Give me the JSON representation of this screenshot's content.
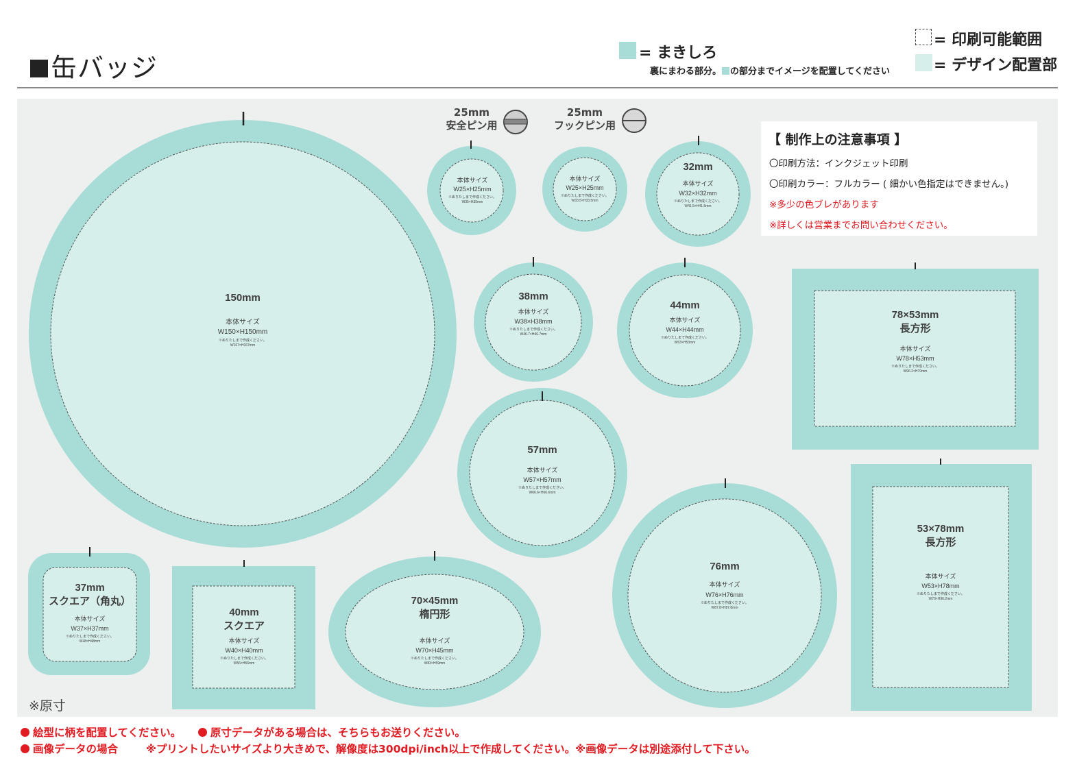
{
  "title": "缶バッジ",
  "legend": {
    "makishiro_label": "= まきしろ",
    "makishiro_note_a": "裏にまわる部分。",
    "makishiro_note_b": "の部分までイメージを配置してください",
    "print_area_label": "= 印刷可能範囲",
    "design_area_label": "= デザイン配置部"
  },
  "pins": {
    "safety_size": "25mm",
    "safety_label": "安全ピン用",
    "hook_size": "25mm",
    "hook_label": "フックピン用"
  },
  "notes": {
    "heading": "【 制作上の注意事項 】",
    "method": "〇印刷方法：インクジェット印刷",
    "color": "〇印刷カラー：フルカラー ( 細かい色指定はできません。)",
    "warn1": "※多少の色ブレがあります",
    "warn2": "※詳しくは営業までお問い合わせください。"
  },
  "colors": {
    "makishiro": "#a8dcd6",
    "design": "#d7efeb",
    "panel": "#eef0ef",
    "warning": "#e01b22"
  },
  "common": {
    "body_label": "本体サイズ",
    "bleed_note": "※ぬりたしまで作成ください。"
  },
  "badges": {
    "b150": {
      "size": "150mm",
      "body": "W150×H150mm",
      "full": "W167×H167mm"
    },
    "b25s": {
      "body": "W25×H25mm",
      "full": "W35×H35mm"
    },
    "b25h": {
      "body": "W25×H25mm",
      "full": "W33.5×H33.5mm"
    },
    "b32": {
      "size": "32mm",
      "body": "W32×H32mm",
      "full": "W41.5×H41.5mm"
    },
    "b38": {
      "size": "38mm",
      "body": "W38×H38mm",
      "full": "W46.7×H46.7mm"
    },
    "b44": {
      "size": "44mm",
      "body": "W44×H44mm",
      "full": "W53×H53mm"
    },
    "b57": {
      "size": "57mm",
      "body": "W57×H57mm",
      "full": "W66.6×H66.6mm"
    },
    "b76": {
      "size": "76mm",
      "body": "W76×H76mm",
      "full": "W87.8×H87.8mm"
    },
    "r7853": {
      "size": "78×53mm",
      "shape": "長方形",
      "body": "W78×H53mm",
      "full": "W96.2×H70mm"
    },
    "r5378": {
      "size": "53×78mm",
      "shape": "長方形",
      "body": "W53×H78mm",
      "full": "W70×H96.2mm"
    },
    "s37": {
      "size": "37mm",
      "shape": "スクエア（角丸）",
      "body": "W37×H37mm",
      "full": "W48×H48mm"
    },
    "s40": {
      "size": "40mm",
      "shape": "スクエア",
      "body": "W40×H40mm",
      "full": "W56×H56mm"
    },
    "o7045": {
      "size": "70×45mm",
      "shape": "楕円形",
      "body": "W70×H45mm",
      "full": "W83×H59mm"
    }
  },
  "scale_note": "※原寸",
  "footer": {
    "line1a": "絵型に柄を配置してください。",
    "line1b": "原寸データがある場合は、そちらもお送りください。",
    "line2a": "画像データの場合",
    "line2b": "※プリントしたいサイズより大きめで、解像度は300dpi/inch以上で作成してください。※画像データは別途添付して下さい。"
  }
}
